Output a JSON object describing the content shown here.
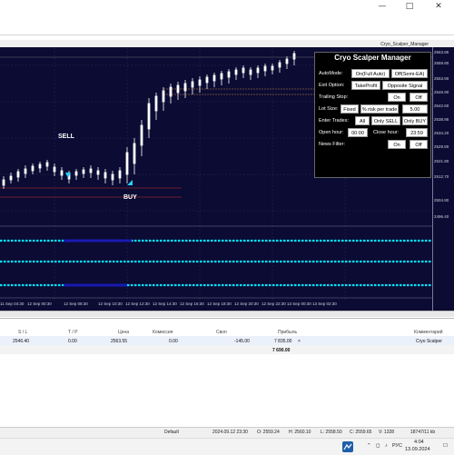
{
  "window": {
    "chart_title": "Cryo_Scalper_Manager"
  },
  "price_axis": [
    "2563.85",
    "2559.80",
    "2553.90",
    "2546.90",
    "2542.60",
    "2538.95",
    "2534.20",
    "2529.80",
    "2521.80",
    "2512.70",
    "2504.80",
    "2496.40"
  ],
  "time_axis": [
    "11 Sep 04:30",
    "12 Sep 00:30",
    "12 Sep 08:30",
    "12 Sep 10:30",
    "12 Sep 12:30",
    "12 Sep 14:30",
    "12 Sep 16:30",
    "12 Sep 18:30",
    "12 Sep 20:30",
    "12 Sep 22:30",
    "13 Sep 00:30",
    "13 Sep 02:30"
  ],
  "signals": {
    "sell": "SELL",
    "buy": "BUY"
  },
  "panel": {
    "title": "Cryo Scalper Manager",
    "automode_label": "AutoMode:",
    "automode_on": "On(Full Auto)",
    "automode_off": "Off(Semi-EA)",
    "exit_label": "Exit Option:",
    "exit_tp": "TakeProfit",
    "exit_opposite": "Opposite Signal",
    "trailing_label": "Trailing Stop:",
    "trailing_on": "On",
    "trailing_off": "Off",
    "lot_label": "Lot Size:",
    "lot_fixed": "Fixed",
    "lot_risk": "% risk per trade",
    "lot_value": "5.00",
    "enter_label": "Enter Trades:",
    "enter_all": "All",
    "enter_sell": "Only SELL",
    "enter_buy": "Only BUY",
    "open_label": "Open hour:",
    "open_value": "00:00",
    "close_label": "Close hour:",
    "close_value": "23:59",
    "news_label": "News Filter:",
    "news_on": "On",
    "news_off": "Off"
  },
  "terminal": {
    "headers": {
      "sl": "S / L",
      "tp": "T / P",
      "price": "Цена",
      "commission": "Комиссия",
      "swap": "Своп",
      "profit": "Прибыль",
      "comment": "Комментарий"
    },
    "row": {
      "sl": "2546.40",
      "tp": "0.00",
      "price": "2563.55",
      "commission": "0.00",
      "swap": "-145.00",
      "profit": "7 835.00",
      "close": "×",
      "comment": "Cryo Scalper"
    },
    "total": "7 690.00"
  },
  "status": {
    "profile": "Default",
    "datetime": "2024.09.12 23:30",
    "open": "O: 2559.24",
    "high": "H: 2560.10",
    "low": "L: 2558.50",
    "close": "C: 2559.65",
    "volume": "V: 1328",
    "traffic": "18747/11 kb"
  },
  "taskbar": {
    "lang": "РУС",
    "time": "4:04",
    "date": "13.09.2024"
  }
}
